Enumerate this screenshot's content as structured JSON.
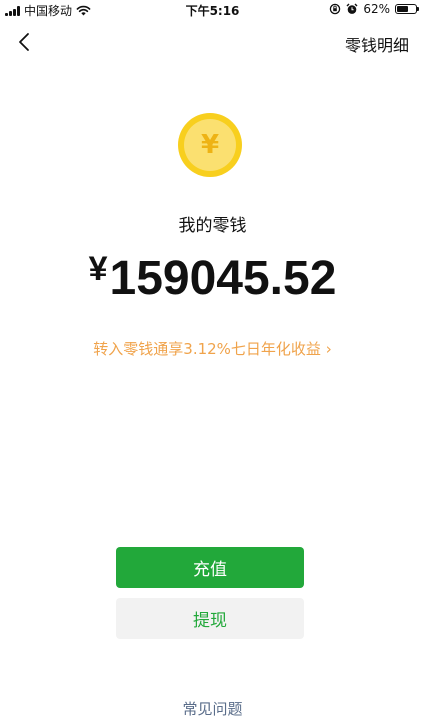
{
  "status_bar": {
    "carrier": "中国移动",
    "time": "下午5:16",
    "battery_percent": "62%",
    "battery_level": 0.62,
    "icons": [
      "signal-icon",
      "wifi-icon",
      "orientation-lock-icon",
      "alarm-icon",
      "battery-icon"
    ]
  },
  "nav": {
    "back_icon": "chevron-left-icon",
    "detail_label": "零钱明细"
  },
  "wallet": {
    "coin_icon": "yuan-coin-icon",
    "coin_symbol": "¥",
    "title": "我的零钱",
    "currency": "¥",
    "balance": "159045.52",
    "promo": "转入零钱通享3.12%七日年化收益 ›"
  },
  "actions": {
    "recharge_label": "充值",
    "withdraw_label": "提现"
  },
  "footer": {
    "faq_label": "常见问题"
  },
  "colors": {
    "primary_green": "#22a83a",
    "promo_orange": "#f0a34b",
    "coin_gold": "#f8cf1e",
    "link_blue_gray": "#5a6d8a"
  }
}
